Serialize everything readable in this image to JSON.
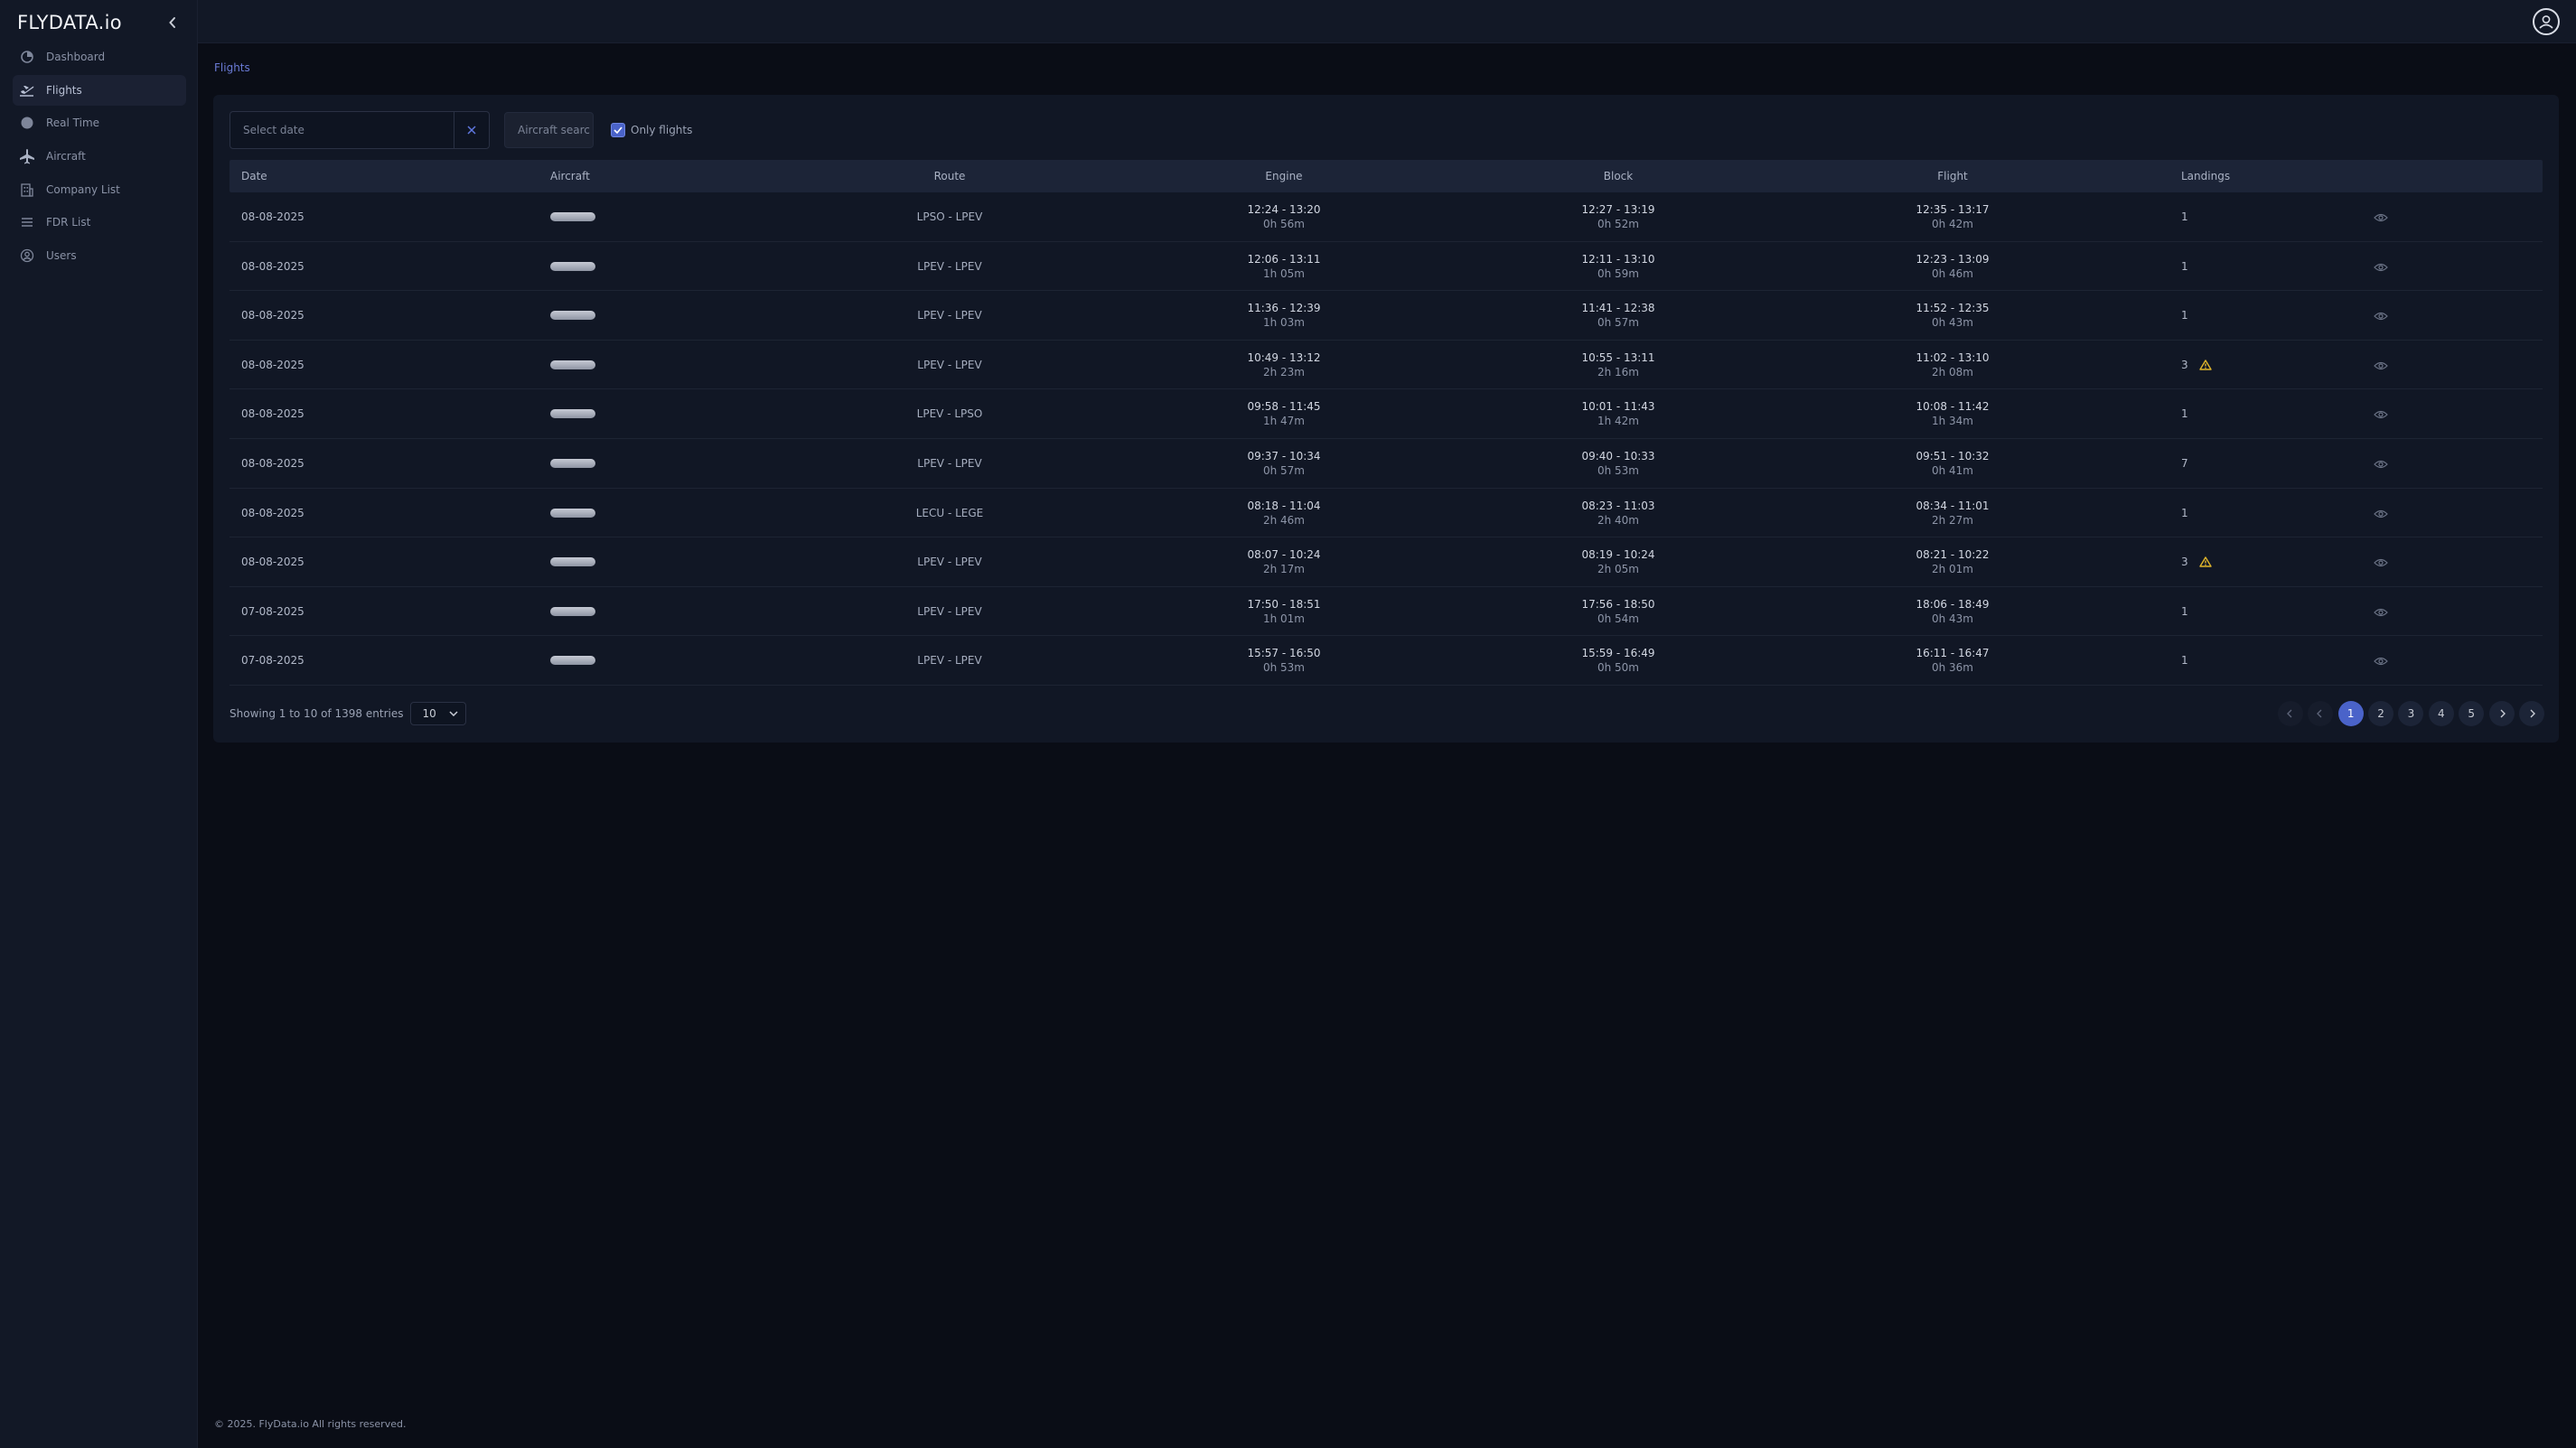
{
  "brand": "FLYDATA.io",
  "sidebar": {
    "items": [
      {
        "label": "Dashboard",
        "icon": "dashboard-icon",
        "active": false
      },
      {
        "label": "Flights",
        "icon": "plane-departure-icon",
        "active": true
      },
      {
        "label": "Real Time",
        "icon": "realtime-icon",
        "active": false
      },
      {
        "label": "Aircraft",
        "icon": "plane-icon",
        "active": false
      },
      {
        "label": "Company List",
        "icon": "building-icon",
        "active": false
      },
      {
        "label": "FDR List",
        "icon": "list-icon",
        "active": false
      },
      {
        "label": "Users",
        "icon": "users-icon",
        "active": false
      }
    ]
  },
  "breadcrumb": "Flights",
  "filters": {
    "date_placeholder": "Select date",
    "aircraft_placeholder": "Aircraft searc",
    "only_flights_label": "Only flights",
    "only_flights_checked": true
  },
  "table": {
    "headers": [
      "Date",
      "Aircraft",
      "Route",
      "Engine",
      "Block",
      "Flight",
      "Landings"
    ],
    "rows": [
      {
        "date": "08-08-2025",
        "route": "LPSO - LPEV",
        "engine": [
          "12:24 - 13:20",
          "0h 56m"
        ],
        "block": [
          "12:27 - 13:19",
          "0h 52m"
        ],
        "flight": [
          "12:35 - 13:17",
          "0h 42m"
        ],
        "landings": "1",
        "warning": false
      },
      {
        "date": "08-08-2025",
        "route": "LPEV - LPEV",
        "engine": [
          "12:06 - 13:11",
          "1h 05m"
        ],
        "block": [
          "12:11 - 13:10",
          "0h 59m"
        ],
        "flight": [
          "12:23 - 13:09",
          "0h 46m"
        ],
        "landings": "1",
        "warning": false
      },
      {
        "date": "08-08-2025",
        "route": "LPEV - LPEV",
        "engine": [
          "11:36 - 12:39",
          "1h 03m"
        ],
        "block": [
          "11:41 - 12:38",
          "0h 57m"
        ],
        "flight": [
          "11:52 - 12:35",
          "0h 43m"
        ],
        "landings": "1",
        "warning": false
      },
      {
        "date": "08-08-2025",
        "route": "LPEV - LPEV",
        "engine": [
          "10:49 - 13:12",
          "2h 23m"
        ],
        "block": [
          "10:55 - 13:11",
          "2h 16m"
        ],
        "flight": [
          "11:02 - 13:10",
          "2h 08m"
        ],
        "landings": "3",
        "warning": true
      },
      {
        "date": "08-08-2025",
        "route": "LPEV - LPSO",
        "engine": [
          "09:58 - 11:45",
          "1h 47m"
        ],
        "block": [
          "10:01 - 11:43",
          "1h 42m"
        ],
        "flight": [
          "10:08 - 11:42",
          "1h 34m"
        ],
        "landings": "1",
        "warning": false
      },
      {
        "date": "08-08-2025",
        "route": "LPEV - LPEV",
        "engine": [
          "09:37 - 10:34",
          "0h 57m"
        ],
        "block": [
          "09:40 - 10:33",
          "0h 53m"
        ],
        "flight": [
          "09:51 - 10:32",
          "0h 41m"
        ],
        "landings": "7",
        "warning": false
      },
      {
        "date": "08-08-2025",
        "route": "LECU - LEGE",
        "engine": [
          "08:18 - 11:04",
          "2h 46m"
        ],
        "block": [
          "08:23 - 11:03",
          "2h 40m"
        ],
        "flight": [
          "08:34 - 11:01",
          "2h 27m"
        ],
        "landings": "1",
        "warning": false
      },
      {
        "date": "08-08-2025",
        "route": "LPEV - LPEV",
        "engine": [
          "08:07 - 10:24",
          "2h 17m"
        ],
        "block": [
          "08:19 - 10:24",
          "2h 05m"
        ],
        "flight": [
          "08:21 - 10:22",
          "2h 01m"
        ],
        "landings": "3",
        "warning": true
      },
      {
        "date": "07-08-2025",
        "route": "LPEV - LPEV",
        "engine": [
          "17:50 - 18:51",
          "1h 01m"
        ],
        "block": [
          "17:56 - 18:50",
          "0h 54m"
        ],
        "flight": [
          "18:06 - 18:49",
          "0h 43m"
        ],
        "landings": "1",
        "warning": false
      },
      {
        "date": "07-08-2025",
        "route": "LPEV - LPEV",
        "engine": [
          "15:57 - 16:50",
          "0h 53m"
        ],
        "block": [
          "15:59 - 16:49",
          "0h 50m"
        ],
        "flight": [
          "16:11 - 16:47",
          "0h 36m"
        ],
        "landings": "1",
        "warning": false
      }
    ]
  },
  "showing_text": "Showing 1 to 10 of 1398 entries",
  "page_size": "10",
  "pagination": {
    "pages": [
      "1",
      "2",
      "3",
      "4",
      "5"
    ],
    "active": "1"
  },
  "footer": "© 2025. FlyData.io All rights reserved.",
  "colors": {
    "accent": "#4a63c9",
    "warning": "#e0b52b",
    "background": "#0a0d16",
    "sidebar": "#121826"
  }
}
